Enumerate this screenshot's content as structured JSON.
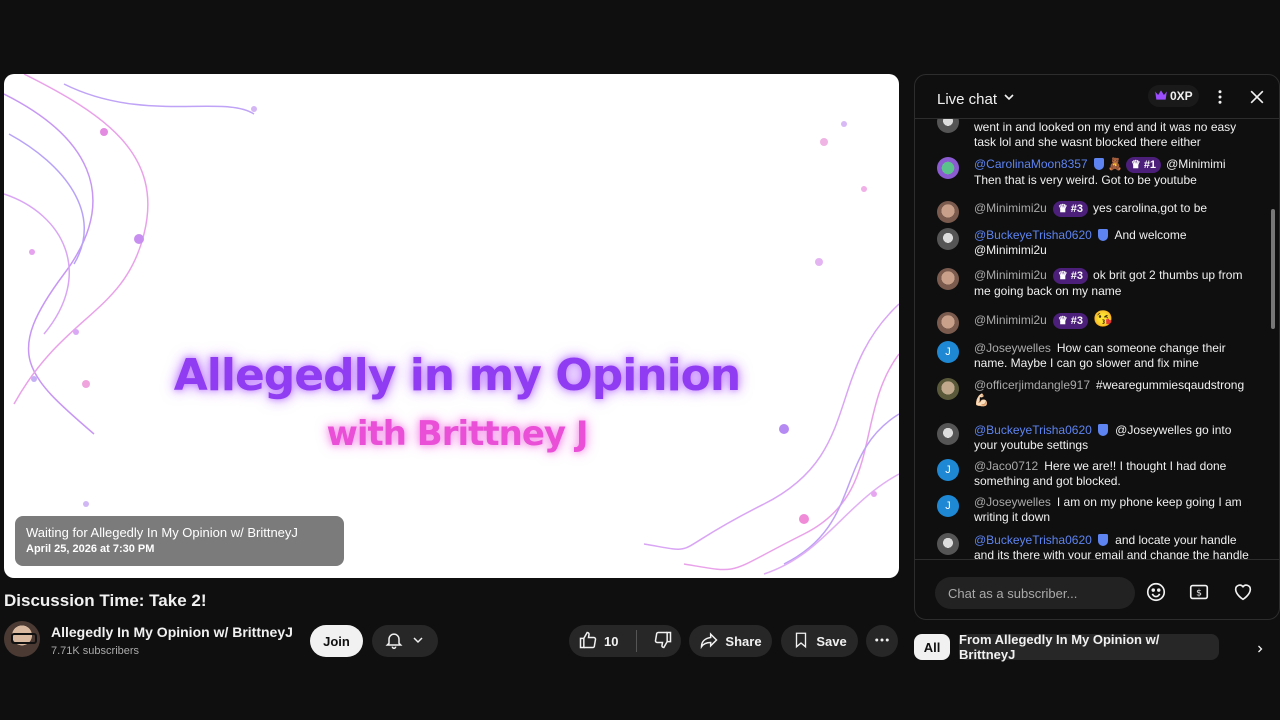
{
  "video": {
    "title_main": "Allegedly in my Opinion",
    "title_sub": "with Brittney J",
    "waiting_text": "Waiting for Allegedly In My Opinion w/ BrittneyJ",
    "waiting_date": "April 25, 2026 at 7:30 PM"
  },
  "info": {
    "title": "Discussion Time: Take 2!",
    "channel_name": "Allegedly In My Opinion w/ BrittneyJ",
    "subscribers": "7.71K subscribers",
    "join_label": "Join",
    "like_count": "10",
    "share_label": "Share",
    "save_label": "Save"
  },
  "chat": {
    "title": "Live chat",
    "xp": "0XP",
    "input_placeholder": "Chat as a subscriber...",
    "messages": [
      {
        "author": "",
        "text": "went in and looked on my end and it was no easy task lol and she wasnt blocked there either"
      },
      {
        "author": "@CarolinaMoon8357",
        "badge": "#1",
        "text": "@Minimimi Then that is very weird. Got to be youtube"
      },
      {
        "author": "@Minimimi2u",
        "badge": "#3",
        "text": "yes carolina,got to be"
      },
      {
        "author": "@BuckeyeTrisha0620",
        "text": "And welcome @Minimimi2u"
      },
      {
        "author": "@Minimimi2u",
        "badge": "#3",
        "text": "ok brit got 2 thumbs up from me going back on my name"
      },
      {
        "author": "@Minimimi2u",
        "badge": "#3",
        "text": "😘"
      },
      {
        "author": "@Joseywelles",
        "avatar_letter": "J",
        "text": "How can someone change their name. Maybe I can go slower and fix mine"
      },
      {
        "author": "@officerjimdangle917",
        "text": "#wearegummiesqaudstrong 💪🏻"
      },
      {
        "author": "@BuckeyeTrisha0620",
        "text": "@Joseywelles go into your youtube settings"
      },
      {
        "author": "@Jaco0712",
        "avatar_letter": "J",
        "text": "Here we are!! I thought I had done something and got blocked."
      },
      {
        "author": "@Joseywelles",
        "avatar_letter": "J",
        "text": "I am on my phone keep going I am writing it down"
      },
      {
        "author": "@BuckeyeTrisha0620",
        "text": "and locate your handle and its there with your email and change the handle"
      }
    ],
    "filters": [
      "All",
      "From Allegedly In My Opinion w/ BrittneyJ"
    ]
  },
  "colors": {
    "accent_purple": "#8f3cf2",
    "accent_pink": "#e94fd7",
    "mention_blue": "#5e84f1"
  }
}
